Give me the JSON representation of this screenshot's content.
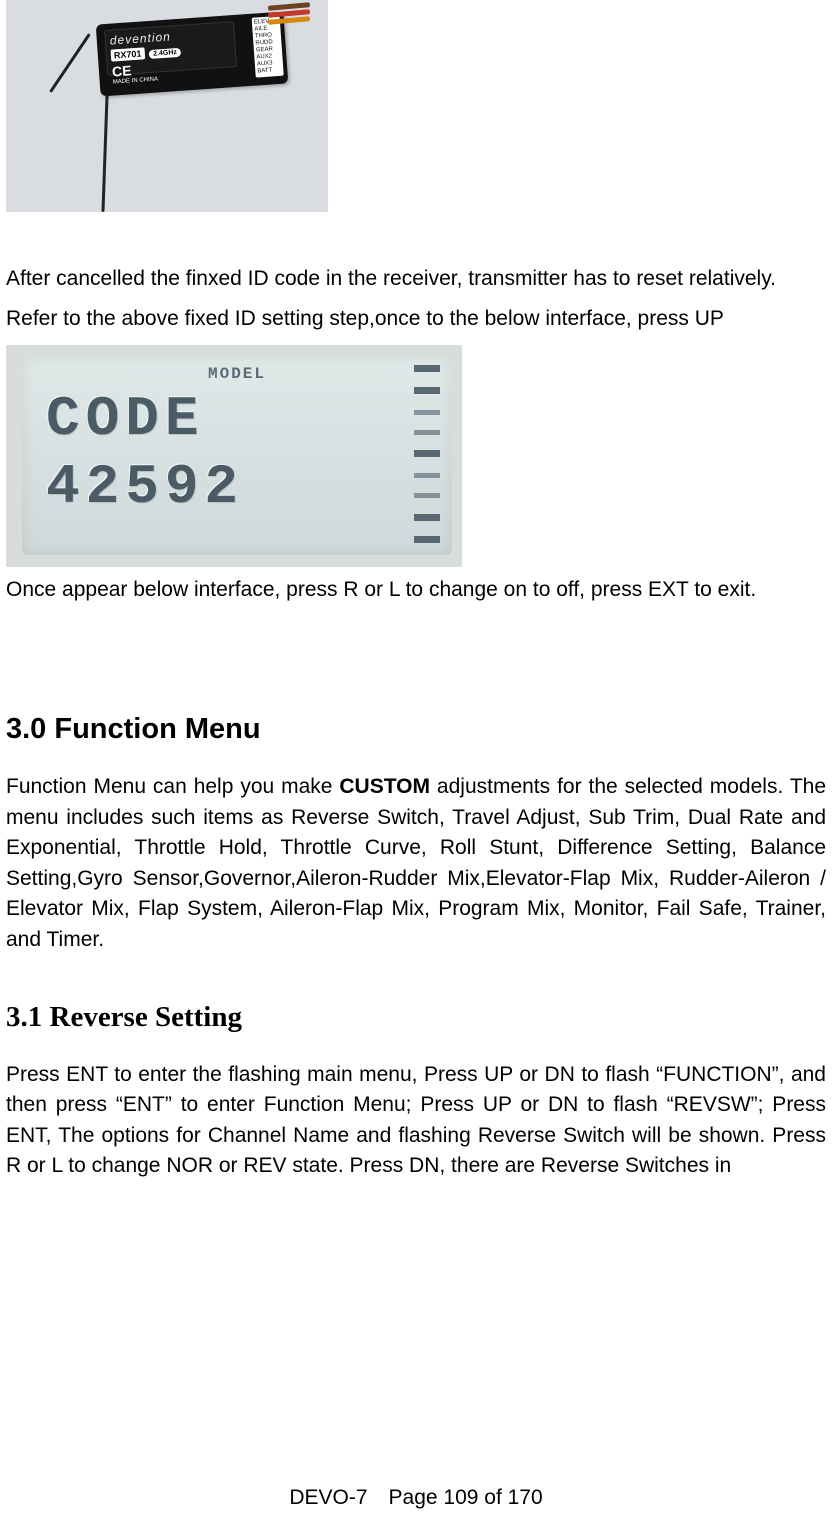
{
  "receiver": {
    "brand": "devention",
    "model": "RX701",
    "freq": "2.4GHz",
    "ce": "CE",
    "made": "MADE IN CHINA",
    "pins": [
      "ELEV",
      "AILE",
      "THRO",
      "RUDD",
      "GEAR",
      "AUX2",
      "AUX3",
      "BATT"
    ]
  },
  "p_after_receiver": "After cancelled the finxed ID code in the receiver, transmitter has to reset relatively.",
  "p_refer": "Refer to the above fixed ID setting step,once to the below interface, press UP",
  "lcd": {
    "model_label": "MODEL",
    "line1": "CODE",
    "line2": "42592"
  },
  "p_after_lcd": "Once appear below interface, press R or L to change on to off, press EXT to exit.",
  "sec30_title": "3.0 Function Menu",
  "sec30_body_pre": "Function Menu can help you make ",
  "sec30_body_bold": "CUSTOM",
  "sec30_body_post": " adjustments for the selected models. The menu includes such items as Reverse Switch, Travel Adjust, Sub Trim, Dual Rate and Exponential, Throttle Hold, Throttle Curve, Roll Stunt, Difference Setting, Balance Setting,Gyro Sensor,Governor,Aileron-Rudder Mix,Elevator-Flap Mix, Rudder-Aileron / Elevator Mix, Flap System, Aileron-Flap Mix, Program Mix, Monitor, Fail Safe, Trainer, and Timer.",
  "sec31_title": "3.1 Reverse Setting",
  "sec31_body": "Press ENT to enter the flashing main menu, Press UP or DN to flash “FUNCTION”, and then press “ENT” to enter Function Menu; Press UP or DN to flash “REVSW”; Press ENT, The options for Channel Name and flashing Reverse Switch will be shown. Press R or L to change NOR or REV state. Press DN, there are Reverse Switches in",
  "footer": "DEVO-7 Page 109 of 170"
}
